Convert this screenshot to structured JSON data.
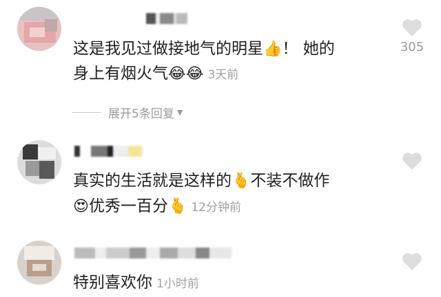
{
  "comments": [
    {
      "text_a": "这是我见过做接地气的明星",
      "emoji_a": "👍",
      "text_b": "！ 她的",
      "text_c": "身上有烟火气",
      "emoji_c1": "😂",
      "emoji_c2": "😂",
      "time": "3天前",
      "likes": "305",
      "replies": "展开5条回复"
    },
    {
      "text_a": "真实的生活就是这样的",
      "emoji_a": "🫰",
      "text_b": "不装不做作",
      "emoji_c0": "😍",
      "text_c": "优秀一百分",
      "emoji_c1": "🫰",
      "time": "12分钟前"
    },
    {
      "text_a": "特别喜欢你",
      "time": "1小时前"
    }
  ],
  "icons": {
    "like": "heart-icon",
    "expand": "caret-down-icon"
  },
  "colors": {
    "text": "#1f1f1f",
    "meta": "#a0a0a0",
    "heart": "#dddddd"
  }
}
